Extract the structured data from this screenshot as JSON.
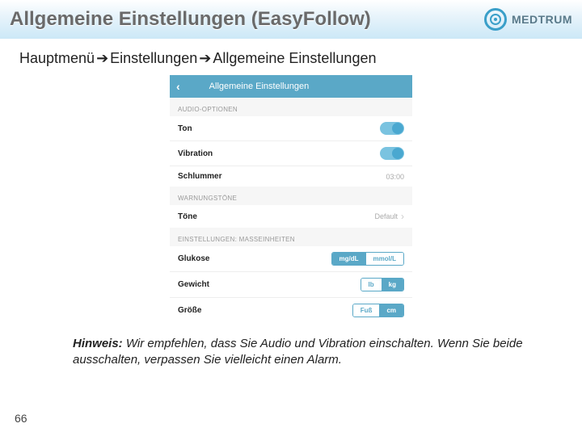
{
  "header": {
    "title": "Allgemeine Einstellungen (EasyFollow)",
    "brand": "MEDTRUM"
  },
  "breadcrumb": {
    "a": "Hauptmenü",
    "b": "Einstellungen",
    "c": "Allgemeine Einstellungen"
  },
  "phone": {
    "headerTitle": "Allgemeine Einstellungen",
    "sections": {
      "audio": {
        "label": "AUDIO-OPTIONEN",
        "ton": "Ton",
        "vibration": "Vibration",
        "schlummer": "Schlummer",
        "schlummerValue": "03:00"
      },
      "warn": {
        "label": "WARNUNGSTÖNE",
        "tone": "Töne",
        "toneValue": "Default"
      },
      "units": {
        "label": "EINSTELLUNGEN: MASSEINHEITEN",
        "glukose": "Glukose",
        "glukoseA": "mg/dL",
        "glukoseB": "mmol/L",
        "gewicht": "Gewicht",
        "gewichtA": "lb",
        "gewichtB": "kg",
        "groesse": "Größe",
        "groesseA": "Fuß",
        "groesseB": "cm"
      }
    }
  },
  "note": {
    "label": "Hinweis:",
    "text": " Wir empfehlen, dass Sie Audio und Vibration einschalten. Wenn Sie beide ausschalten, verpassen Sie vielleicht einen Alarm."
  },
  "pageNumber": "66"
}
